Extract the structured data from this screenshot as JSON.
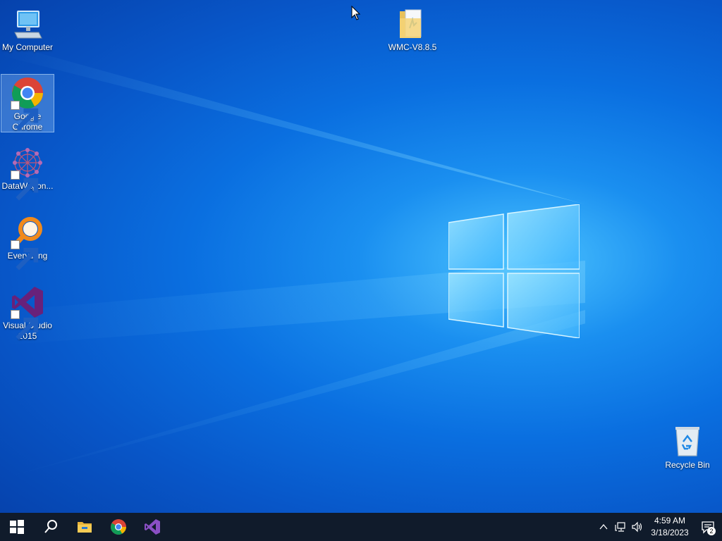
{
  "desktop": {
    "icons": [
      {
        "label": "My Computer",
        "icon": "computer-icon"
      },
      {
        "label": "Google Chrome",
        "icon": "chrome-icon",
        "selected": true
      },
      {
        "label": "DataWagon...",
        "icon": "datawagon-icon"
      },
      {
        "label": "Everything",
        "icon": "everything-icon"
      },
      {
        "label": "Visual Studio 2015",
        "icon": "visual-studio-icon"
      },
      {
        "label": "WMC-V8.8.5",
        "icon": "folder-icon"
      },
      {
        "label": "Recycle Bin",
        "icon": "recycle-bin-icon"
      }
    ]
  },
  "taskbar": {
    "pinned": [
      "windows-start-icon",
      "search-icon",
      "file-explorer-icon",
      "chrome-icon",
      "visual-studio-icon"
    ],
    "tray": {
      "icons": [
        "chevron-up-icon",
        "network-icon",
        "volume-icon"
      ],
      "time": "4:59 AM",
      "date": "3/18/2023",
      "notification_count": "2"
    }
  },
  "colors": {
    "taskbar": "#101b2b",
    "desktop_accent": "#0a6fe0"
  }
}
